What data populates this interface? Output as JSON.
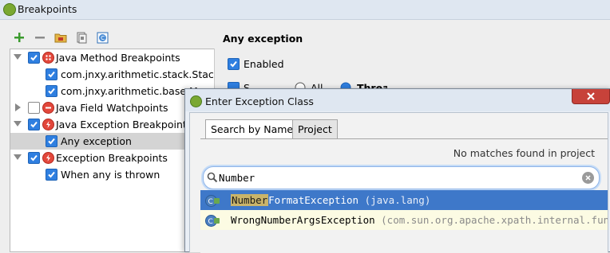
{
  "window": {
    "title": "Breakpoints"
  },
  "tree": [
    {
      "label": "Java Method Breakpoints",
      "checked": true,
      "level": 0,
      "expanded": true,
      "icon": "method-breakpoint-icon"
    },
    {
      "label": "com.jnxy.arithmetic.stack.StackArr",
      "checked": true,
      "level": 1
    },
    {
      "label": "com.jnxy.arithmetic.base.Ma",
      "checked": true,
      "level": 1
    },
    {
      "label": "Java Field Watchpoints",
      "checked": false,
      "level": 0,
      "expanded": false,
      "icon": "field-watchpoint-icon"
    },
    {
      "label": "Java Exception Breakpoints",
      "checked": true,
      "level": 0,
      "expanded": true,
      "icon": "exception-breakpoint-icon"
    },
    {
      "label": "Any exception",
      "checked": true,
      "level": 1,
      "selected": true
    },
    {
      "label": "Exception Breakpoints",
      "checked": true,
      "level": 0,
      "expanded": true,
      "icon": "exception-breakpoint-icon"
    },
    {
      "label": "When any is thrown",
      "checked": true,
      "level": 1
    }
  ],
  "detail": {
    "title": "Any exception",
    "enabled_label": "Enabled",
    "peek_suspend": "S",
    "peek_all": "All",
    "peek_thread": "Thread"
  },
  "dialog": {
    "title": "Enter Exception Class",
    "tabs": [
      "Search by Name",
      "Project"
    ],
    "no_matches": "No matches found in project",
    "search_value": "Number",
    "results": [
      {
        "highlight": "Number",
        "rest": "FormatException",
        "package": "(java.lang)"
      },
      {
        "highlight": "",
        "rest": "WrongNumberArgsException",
        "package": "(com.sun.org.apache.xpath.internal.functi"
      }
    ]
  },
  "colors": {
    "accent": "#3e78c9",
    "checkbox": "#2f7fe0",
    "highlight": "#c9b46a",
    "close": "#c7423a"
  }
}
